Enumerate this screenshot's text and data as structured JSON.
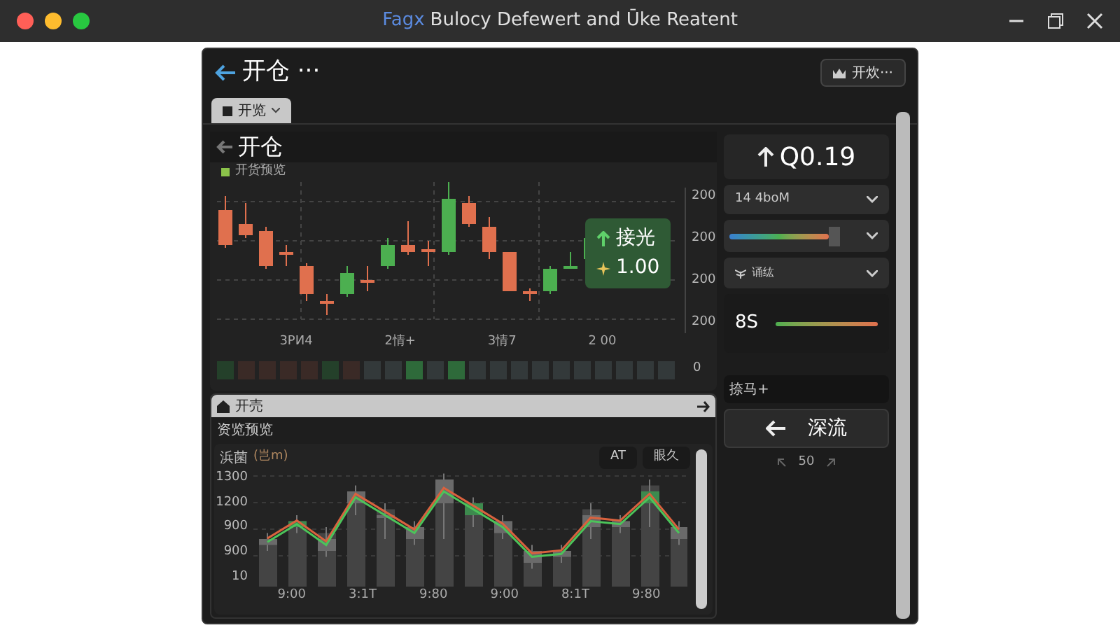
{
  "window": {
    "badge": "Fagx",
    "title": "Bulocy Defewert and Ūke Reatent"
  },
  "header": {
    "title": "开仓 ···",
    "button": "开炊···"
  },
  "tab": {
    "label": "开览"
  },
  "chart_panel": {
    "title": "开仓",
    "legend": "开货预览",
    "y_ticks": [
      "200",
      "200",
      "200",
      "200"
    ],
    "volume_tick": "0",
    "x_ticks": [
      "3РИ4",
      "2情+",
      "3情7",
      "2 00"
    ],
    "tooltip": {
      "label": "接光",
      "value": "1.00"
    }
  },
  "side": {
    "price": "Q0.19",
    "dropdown": "14 4boM",
    "slider": {
      "level": 0.85
    },
    "select": "诵纮",
    "reading": "8S",
    "input_value": "捺马+",
    "button": "深流",
    "pager": "50"
  },
  "lower_panel": {
    "title": "开売",
    "subtitle": "资览预览",
    "chart_title": "浜菌",
    "unit": "(岂m)",
    "buttons": [
      "AT",
      "眼久"
    ],
    "y_ticks": [
      "1300",
      "1200",
      "900",
      "900",
      "10"
    ],
    "x_ticks": [
      "9:00",
      "3:1T",
      "9:80",
      "9:00",
      "8:1T",
      "9:80"
    ]
  }
}
